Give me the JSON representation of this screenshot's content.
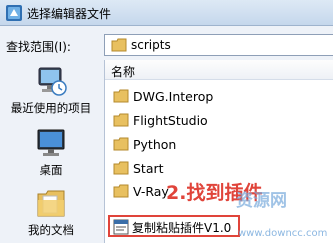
{
  "window": {
    "title": "选择编辑器文件"
  },
  "lookin": {
    "label": "查找范围(I):",
    "value": "scripts"
  },
  "places": [
    {
      "label": "最近使用的项目",
      "icon": "recent-items-icon"
    },
    {
      "label": "桌面",
      "icon": "desktop-icon"
    },
    {
      "label": "我的文档",
      "icon": "documents-icon"
    }
  ],
  "filelist": {
    "column_name": "名称",
    "folders": [
      "DWG.Interop",
      "FlightStudio",
      "Python",
      "Start",
      "V-Ray"
    ],
    "files": [
      "复制粘贴插件V1.0"
    ]
  },
  "annotation": {
    "text": "2.找到插件",
    "color": "#e0443a"
  },
  "watermark": {
    "text": "资源网",
    "url": "www.downcc.com"
  }
}
